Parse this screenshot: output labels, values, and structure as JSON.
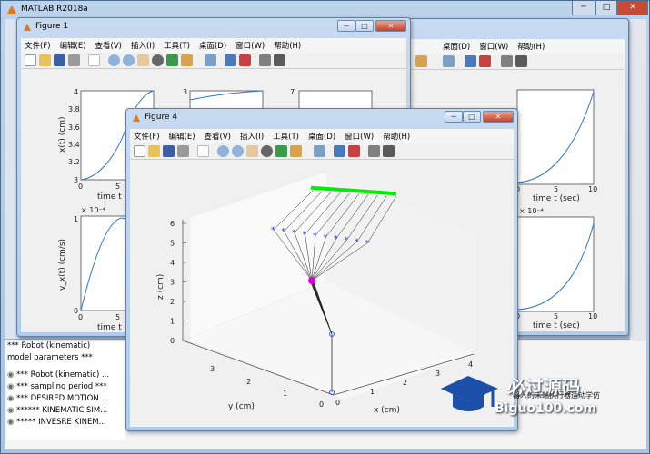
{
  "main_window": {
    "title": "MATLAB R2018a",
    "buttons": {
      "minimize": "─",
      "maximize": "□",
      "close": "✕"
    }
  },
  "figure1": {
    "title": "Figure 1",
    "menu": [
      "文件(F)",
      "编辑(E)",
      "查看(V)",
      "插入(I)",
      "工具(T)",
      "桌面(D)",
      "窗口(W)",
      "帮助(H)"
    ],
    "plot_top_left": {
      "ylabel": "x(t) (cm)",
      "xlabel": "time t (s",
      "yticks": [
        "4",
        "3.8",
        "3.6",
        "3.4",
        "3.2",
        "3"
      ],
      "xticks": [
        "0",
        "5"
      ]
    },
    "plot_top_mid": {
      "ytick_top": "3"
    },
    "plot_top_right": {
      "ytick_top": "7"
    },
    "plot_bottom_left": {
      "exponent": "× 10⁻⁴",
      "ylabel": "v_x(t) (cm/s)",
      "xlabel": "time t (s",
      "yticks": [
        "1",
        "0"
      ],
      "xticks": [
        "0",
        "5"
      ]
    },
    "plot_top_far_right": {
      "xlabel": "time t (sec)",
      "xticks": [
        "0",
        "5",
        "10"
      ]
    },
    "plot_bottom_far_right": {
      "exponent": "× 10⁻⁴",
      "xlabel": "time t (sec)",
      "xticks": [
        "0",
        "5",
        "10"
      ]
    }
  },
  "figure_back_menu": [
    "文件(F)",
    "编辑(E)",
    "查看(V)",
    "插入(I)",
    "工具(T)",
    "桌面(D)",
    "窗口(W)",
    "帮助(H)"
  ],
  "figure4": {
    "title": "Figure 4",
    "menu": [
      "文件(F)",
      "编辑(E)",
      "查看(V)",
      "插入(I)",
      "工具(T)",
      "桌面(D)",
      "窗口(W)",
      "帮助(H)"
    ],
    "zlabel": "z (cm)",
    "ylabel": "y (cm)",
    "xlabel": "x (cm)",
    "zticks": [
      "6",
      "5",
      "4",
      "3",
      "2",
      "1",
      "0"
    ],
    "yticks": [
      "3",
      "2",
      "1",
      "0"
    ],
    "xticks": [
      "0",
      "1",
      "2",
      "3",
      "4"
    ],
    "colors": {
      "end_effector_path": "#00ee00",
      "joint_markers": "#2233dd",
      "base_joint": "#dd00dd"
    }
  },
  "command_window": {
    "lines": [
      "*** Robot (kinematic)",
      "model parameters ***"
    ],
    "items": [
      "*** Robot (kinematic) ...",
      "*** sampling period ***",
      "*** DESIRED MOTION ...",
      "****** KINEMATIC SIM...",
      "***** INVESRE KINEM..."
    ]
  },
  "watermark": {
    "brand": "必过源码",
    "url": "Biguo100.com",
    "side_text": "器人的末端执行器运动学仿"
  }
}
